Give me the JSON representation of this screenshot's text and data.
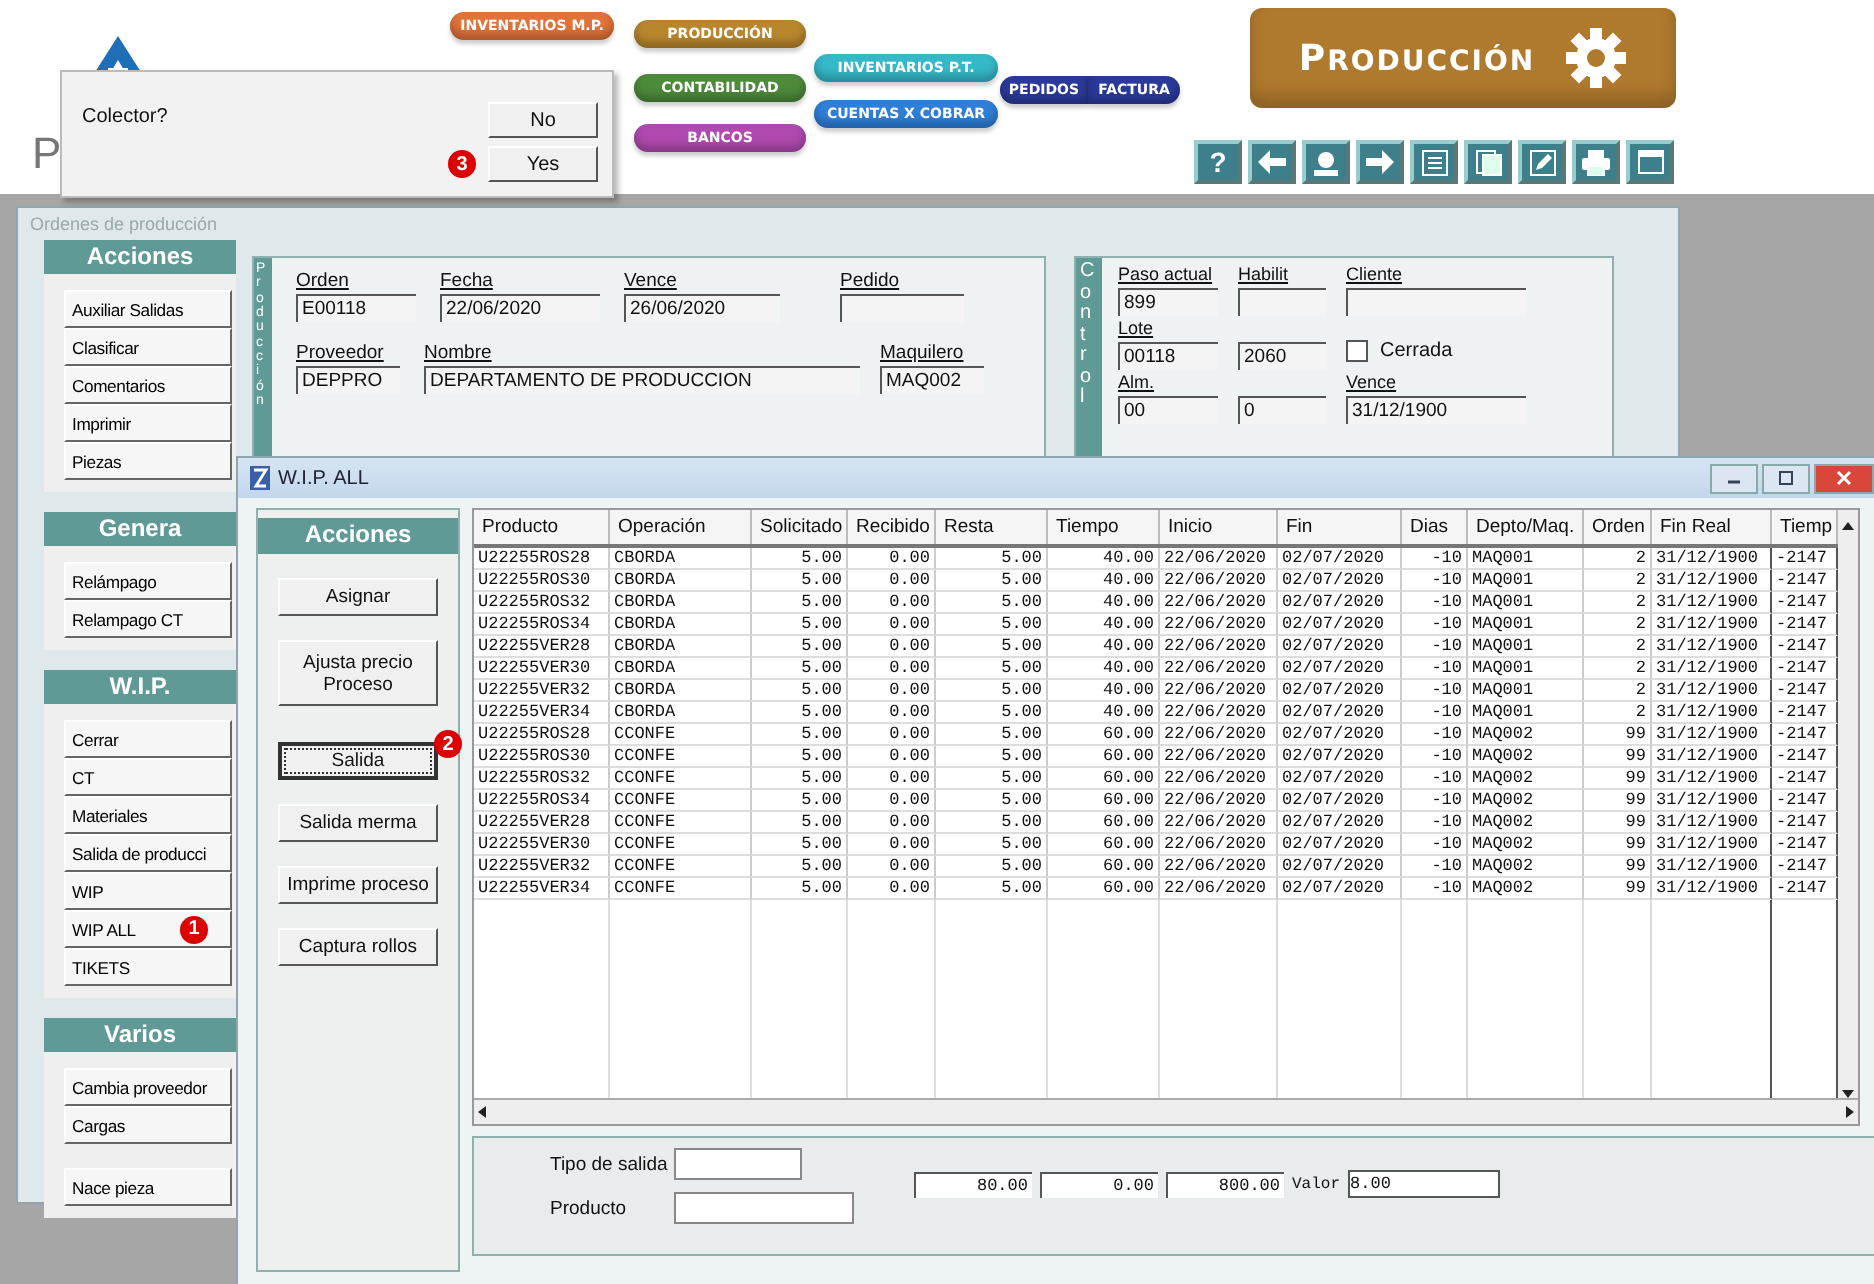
{
  "header": {
    "page_title": "P",
    "modules": [
      {
        "label": "INVENTARIOS M.P.",
        "color": "#e0733a"
      },
      {
        "label": "PRODUCCIÓN",
        "color": "#b8862d"
      },
      {
        "label": "CONTABILIDAD",
        "color": "#4d8a3a"
      },
      {
        "label": "BANCOS",
        "color": "#b04ab0"
      },
      {
        "label": "INVENTARIOS P.T.",
        "color": "#35b8c8"
      },
      {
        "label": "CUENTAS X COBRAR",
        "color": "#2f7fd8"
      },
      {
        "label": "PEDIDOS",
        "color": "#2b3a9a"
      },
      {
        "label": "FACTURA",
        "color": "#2b3a9a"
      }
    ],
    "banner_title": "PRODUCCIÓN",
    "help_glyph": "?"
  },
  "dialog": {
    "message": "Colector?",
    "buttons": [
      {
        "label": "No"
      },
      {
        "label": "Yes",
        "badge": "3"
      }
    ]
  },
  "main_window": {
    "title": "Ordenes de producción",
    "sidebar": [
      {
        "title": "Acciones",
        "items": [
          {
            "label": "Auxiliar Salidas"
          },
          {
            "label": "Clasificar"
          },
          {
            "label": "Comentarios"
          },
          {
            "label": "Imprimir"
          },
          {
            "label": "Piezas"
          }
        ]
      },
      {
        "title": "Genera",
        "items": [
          {
            "label": "Relámpago"
          },
          {
            "label": "Relampago CT"
          }
        ]
      },
      {
        "title": "W.I.P.",
        "items": [
          {
            "label": "Cerrar"
          },
          {
            "label": "CT"
          },
          {
            "label": "Materiales"
          },
          {
            "label": "Salida de producci"
          },
          {
            "label": "WIP"
          },
          {
            "label": "WIP ALL",
            "badge": "1"
          },
          {
            "label": "TIKETS"
          }
        ]
      },
      {
        "title": "Varios",
        "items": [
          {
            "label": "Cambia proveedor"
          },
          {
            "label": "Cargas"
          },
          {
            "label": "Nace pieza"
          }
        ]
      }
    ],
    "production": {
      "side_label": "Producción",
      "fields": [
        {
          "label": "Orden",
          "value": "E00118"
        },
        {
          "label": "Fecha",
          "value": "22/06/2020"
        },
        {
          "label": "Vence",
          "value": "26/06/2020"
        },
        {
          "label": "Pedido"
        },
        {
          "label": "Proveedor",
          "value": "DEPPRO"
        },
        {
          "label": "Nombre",
          "value": "DEPARTAMENTO  DE PRODUCCION"
        },
        {
          "label": "Maquilero",
          "value": "MAQ002"
        }
      ]
    },
    "control": {
      "side_label": "Control",
      "items": [
        {
          "kind": "field",
          "label": "Paso actual",
          "value": "899"
        },
        {
          "kind": "field",
          "label": "Habilit"
        },
        {
          "kind": "field",
          "label": "Cliente"
        },
        {
          "kind": "field",
          "label": "Lote",
          "value": "00118"
        },
        {
          "kind": "field",
          "value": "2060"
        },
        {
          "kind": "checkbox",
          "label": "Cerrada",
          "checked": false
        },
        {
          "kind": "field",
          "label": "Alm.",
          "value": "00"
        },
        {
          "kind": "field",
          "value": "0"
        },
        {
          "kind": "field",
          "label": "Vence",
          "value": "31/12/1900"
        }
      ]
    }
  },
  "wip_window": {
    "title": "W.I.P. ALL",
    "actions_title": "Acciones",
    "actions": [
      {
        "label": "Asignar",
        "focused": false
      },
      {
        "label": "Ajusta precio Proceso",
        "focused": false
      },
      {
        "label": "Salida",
        "badge": "2",
        "focused": true
      },
      {
        "label": "Salida merma",
        "focused": false
      },
      {
        "label": "Imprime  proceso",
        "focused": false
      },
      {
        "label": "Captura rollos",
        "focused": false
      }
    ],
    "table": {
      "columns": [
        "Producto",
        "Operación",
        "Solicitado",
        "Recibido",
        "Resta",
        "Tiempo",
        "Inicio",
        "Fin",
        "Dias",
        "Depto/Maq.",
        "Orden",
        "Fin Real",
        "Tiemp"
      ],
      "rows": [
        [
          "U22255ROS28",
          "CBORDA",
          "5.00",
          "0.00",
          "5.00",
          "40.00",
          "22/06/2020",
          "02/07/2020",
          "-10",
          "MAQ001",
          "2",
          "31/12/1900",
          "-2147"
        ],
        [
          "U22255ROS30",
          "CBORDA",
          "5.00",
          "0.00",
          "5.00",
          "40.00",
          "22/06/2020",
          "02/07/2020",
          "-10",
          "MAQ001",
          "2",
          "31/12/1900",
          "-2147"
        ],
        [
          "U22255ROS32",
          "CBORDA",
          "5.00",
          "0.00",
          "5.00",
          "40.00",
          "22/06/2020",
          "02/07/2020",
          "-10",
          "MAQ001",
          "2",
          "31/12/1900",
          "-2147"
        ],
        [
          "U22255ROS34",
          "CBORDA",
          "5.00",
          "0.00",
          "5.00",
          "40.00",
          "22/06/2020",
          "02/07/2020",
          "-10",
          "MAQ001",
          "2",
          "31/12/1900",
          "-2147"
        ],
        [
          "U22255VER28",
          "CBORDA",
          "5.00",
          "0.00",
          "5.00",
          "40.00",
          "22/06/2020",
          "02/07/2020",
          "-10",
          "MAQ001",
          "2",
          "31/12/1900",
          "-2147"
        ],
        [
          "U22255VER30",
          "CBORDA",
          "5.00",
          "0.00",
          "5.00",
          "40.00",
          "22/06/2020",
          "02/07/2020",
          "-10",
          "MAQ001",
          "2",
          "31/12/1900",
          "-2147"
        ],
        [
          "U22255VER32",
          "CBORDA",
          "5.00",
          "0.00",
          "5.00",
          "40.00",
          "22/06/2020",
          "02/07/2020",
          "-10",
          "MAQ001",
          "2",
          "31/12/1900",
          "-2147"
        ],
        [
          "U22255VER34",
          "CBORDA",
          "5.00",
          "0.00",
          "5.00",
          "40.00",
          "22/06/2020",
          "02/07/2020",
          "-10",
          "MAQ001",
          "2",
          "31/12/1900",
          "-2147"
        ],
        [
          "U22255ROS28",
          "CCONFE",
          "5.00",
          "0.00",
          "5.00",
          "60.00",
          "22/06/2020",
          "02/07/2020",
          "-10",
          "MAQ002",
          "99",
          "31/12/1900",
          "-2147"
        ],
        [
          "U22255ROS30",
          "CCONFE",
          "5.00",
          "0.00",
          "5.00",
          "60.00",
          "22/06/2020",
          "02/07/2020",
          "-10",
          "MAQ002",
          "99",
          "31/12/1900",
          "-2147"
        ],
        [
          "U22255ROS32",
          "CCONFE",
          "5.00",
          "0.00",
          "5.00",
          "60.00",
          "22/06/2020",
          "02/07/2020",
          "-10",
          "MAQ002",
          "99",
          "31/12/1900",
          "-2147"
        ],
        [
          "U22255ROS34",
          "CCONFE",
          "5.00",
          "0.00",
          "5.00",
          "60.00",
          "22/06/2020",
          "02/07/2020",
          "-10",
          "MAQ002",
          "99",
          "31/12/1900",
          "-2147"
        ],
        [
          "U22255VER28",
          "CCONFE",
          "5.00",
          "0.00",
          "5.00",
          "60.00",
          "22/06/2020",
          "02/07/2020",
          "-10",
          "MAQ002",
          "99",
          "31/12/1900",
          "-2147"
        ],
        [
          "U22255VER30",
          "CCONFE",
          "5.00",
          "0.00",
          "5.00",
          "60.00",
          "22/06/2020",
          "02/07/2020",
          "-10",
          "MAQ002",
          "99",
          "31/12/1900",
          "-2147"
        ],
        [
          "U22255VER32",
          "CCONFE",
          "5.00",
          "0.00",
          "5.00",
          "60.00",
          "22/06/2020",
          "02/07/2020",
          "-10",
          "MAQ002",
          "99",
          "31/12/1900",
          "-2147"
        ],
        [
          "U22255VER34",
          "CCONFE",
          "5.00",
          "0.00",
          "5.00",
          "60.00",
          "22/06/2020",
          "02/07/2020",
          "-10",
          "MAQ002",
          "99",
          "31/12/1900",
          "-2147"
        ]
      ]
    },
    "footer": {
      "tipo_label": "Tipo de salida",
      "producto_label": "Producto",
      "totals": [
        "80.00",
        "0.00",
        "800.00"
      ],
      "valor_label": "Valor",
      "valor": "8.00"
    }
  }
}
